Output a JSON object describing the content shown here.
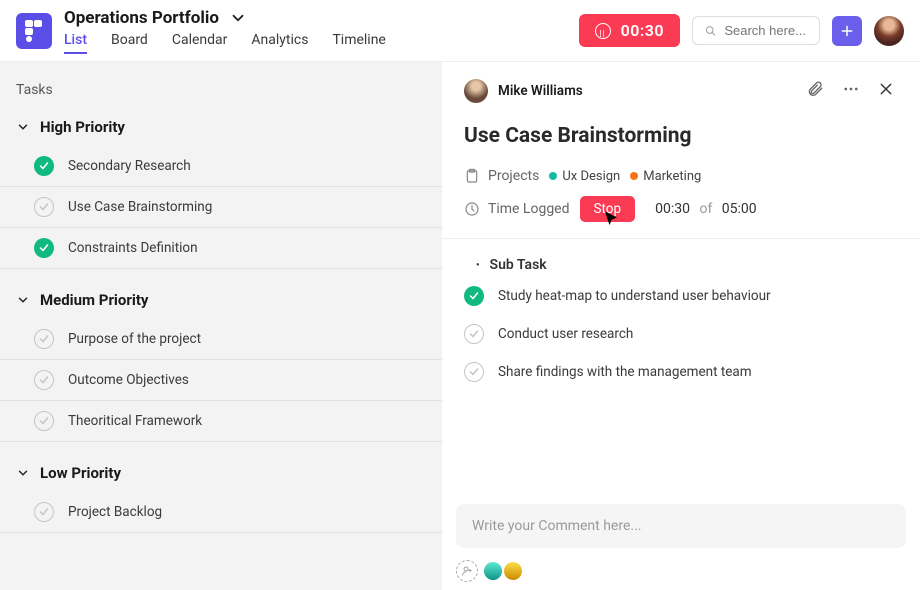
{
  "header": {
    "title": "Operations Portfolio",
    "tabs": [
      "List",
      "Board",
      "Calendar",
      "Analytics",
      "Timeline"
    ],
    "timer": "00:30",
    "search_placeholder": "Search here..."
  },
  "task_panel": {
    "heading": "Tasks",
    "groups": [
      {
        "title": "High Priority",
        "tasks": [
          {
            "done": true,
            "label": "Secondary Research"
          },
          {
            "done": false,
            "label": "Use Case Brainstorming"
          },
          {
            "done": true,
            "label": "Constraints Definition"
          }
        ]
      },
      {
        "title": "Medium Priority",
        "tasks": [
          {
            "done": false,
            "label": "Purpose of the project"
          },
          {
            "done": false,
            "label": "Outcome Objectives"
          },
          {
            "done": false,
            "label": "Theoritical Framework"
          }
        ]
      },
      {
        "title": "Low Priority",
        "tasks": [
          {
            "done": false,
            "label": "Project Backlog"
          }
        ]
      }
    ]
  },
  "detail": {
    "author": "Mike Williams",
    "title": "Use Case Brainstorming",
    "projects_label": "Projects",
    "projects": [
      {
        "color": "teal",
        "name": "Ux Design"
      },
      {
        "color": "orange",
        "name": "Marketing"
      }
    ],
    "time_label": "Time Logged",
    "stop_label": "Stop",
    "time_done": "00:30",
    "time_of": "of",
    "time_total": "05:00",
    "subtask_heading": "Sub Task",
    "subtasks": [
      {
        "done": true,
        "label": "Study heat-map to understand user behaviour"
      },
      {
        "done": false,
        "label": "Conduct user research"
      },
      {
        "done": false,
        "label": "Share findings with the management team"
      }
    ],
    "comment_placeholder": "Write your Comment here..."
  }
}
